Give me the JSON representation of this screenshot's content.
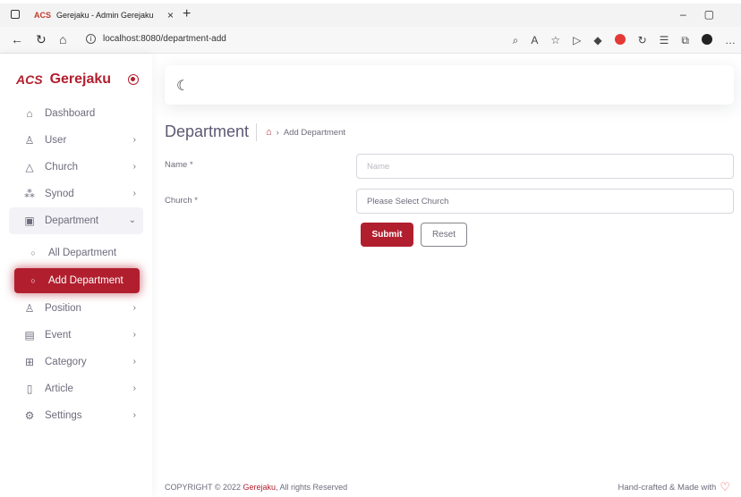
{
  "browser": {
    "tab_title": "Gerejaku - Admin Gerejaku",
    "tab_favicon": "ACS",
    "url": "localhost:8080/department-add"
  },
  "sidebar": {
    "brand_logo": "ACS",
    "brand_name": "Gerejaku",
    "items": [
      {
        "label": "Dashboard",
        "icon": "home-icon"
      },
      {
        "label": "User",
        "icon": "user-icon"
      },
      {
        "label": "Church",
        "icon": "triangle-icon"
      },
      {
        "label": "Synod",
        "icon": "synod-icon"
      },
      {
        "label": "Department",
        "icon": "department-icon"
      },
      {
        "label": "All Department",
        "icon": "circle-icon"
      },
      {
        "label": "Add Department",
        "icon": "circle-icon"
      },
      {
        "label": "Position",
        "icon": "user-check-icon"
      },
      {
        "label": "Event",
        "icon": "calendar-icon"
      },
      {
        "label": "Category",
        "icon": "grid-icon"
      },
      {
        "label": "Article",
        "icon": "file-icon"
      },
      {
        "label": "Settings",
        "icon": "settings-icon"
      }
    ]
  },
  "page": {
    "title": "Department",
    "breadcrumb_current": "Add Department"
  },
  "form": {
    "name_label": "Name *",
    "name_placeholder": "Name",
    "church_label": "Church *",
    "church_placeholder": "Please Select Church",
    "submit_label": "Submit",
    "reset_label": "Reset"
  },
  "footer": {
    "copyright_prefix": "COPYRIGHT © 2022",
    "copyright_brand": "Gerejaku",
    "copyright_suffix": ", All rights Reserved",
    "right_text": "Hand-crafted & Made with"
  },
  "colors": {
    "accent": "#b11f2e",
    "heart": "#ea5455"
  }
}
